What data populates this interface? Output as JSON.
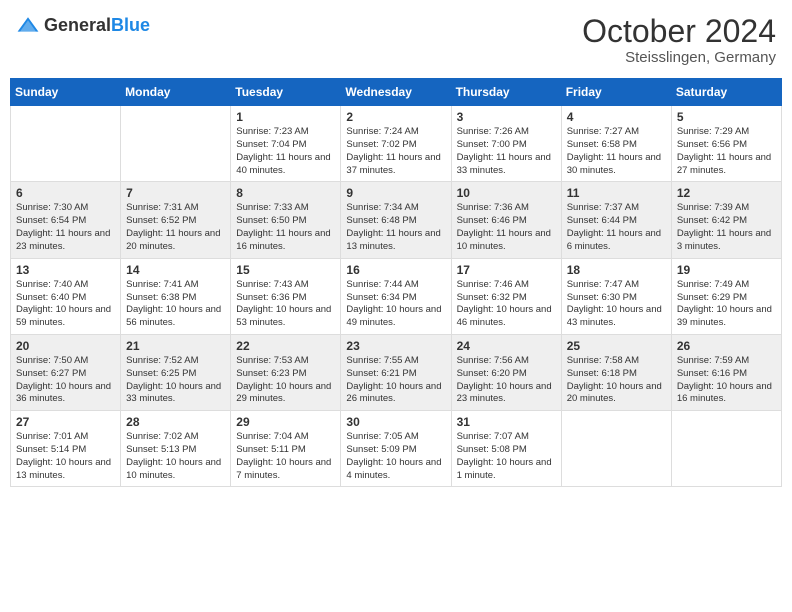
{
  "header": {
    "logo_general": "General",
    "logo_blue": "Blue",
    "month_year": "October 2024",
    "location": "Steisslingen, Germany"
  },
  "days_of_week": [
    "Sunday",
    "Monday",
    "Tuesday",
    "Wednesday",
    "Thursday",
    "Friday",
    "Saturday"
  ],
  "weeks": [
    [
      {
        "day": "",
        "info": ""
      },
      {
        "day": "",
        "info": ""
      },
      {
        "day": "1",
        "info": "Sunrise: 7:23 AM\nSunset: 7:04 PM\nDaylight: 11 hours and 40 minutes."
      },
      {
        "day": "2",
        "info": "Sunrise: 7:24 AM\nSunset: 7:02 PM\nDaylight: 11 hours and 37 minutes."
      },
      {
        "day": "3",
        "info": "Sunrise: 7:26 AM\nSunset: 7:00 PM\nDaylight: 11 hours and 33 minutes."
      },
      {
        "day": "4",
        "info": "Sunrise: 7:27 AM\nSunset: 6:58 PM\nDaylight: 11 hours and 30 minutes."
      },
      {
        "day": "5",
        "info": "Sunrise: 7:29 AM\nSunset: 6:56 PM\nDaylight: 11 hours and 27 minutes."
      }
    ],
    [
      {
        "day": "6",
        "info": "Sunrise: 7:30 AM\nSunset: 6:54 PM\nDaylight: 11 hours and 23 minutes."
      },
      {
        "day": "7",
        "info": "Sunrise: 7:31 AM\nSunset: 6:52 PM\nDaylight: 11 hours and 20 minutes."
      },
      {
        "day": "8",
        "info": "Sunrise: 7:33 AM\nSunset: 6:50 PM\nDaylight: 11 hours and 16 minutes."
      },
      {
        "day": "9",
        "info": "Sunrise: 7:34 AM\nSunset: 6:48 PM\nDaylight: 11 hours and 13 minutes."
      },
      {
        "day": "10",
        "info": "Sunrise: 7:36 AM\nSunset: 6:46 PM\nDaylight: 11 hours and 10 minutes."
      },
      {
        "day": "11",
        "info": "Sunrise: 7:37 AM\nSunset: 6:44 PM\nDaylight: 11 hours and 6 minutes."
      },
      {
        "day": "12",
        "info": "Sunrise: 7:39 AM\nSunset: 6:42 PM\nDaylight: 11 hours and 3 minutes."
      }
    ],
    [
      {
        "day": "13",
        "info": "Sunrise: 7:40 AM\nSunset: 6:40 PM\nDaylight: 10 hours and 59 minutes."
      },
      {
        "day": "14",
        "info": "Sunrise: 7:41 AM\nSunset: 6:38 PM\nDaylight: 10 hours and 56 minutes."
      },
      {
        "day": "15",
        "info": "Sunrise: 7:43 AM\nSunset: 6:36 PM\nDaylight: 10 hours and 53 minutes."
      },
      {
        "day": "16",
        "info": "Sunrise: 7:44 AM\nSunset: 6:34 PM\nDaylight: 10 hours and 49 minutes."
      },
      {
        "day": "17",
        "info": "Sunrise: 7:46 AM\nSunset: 6:32 PM\nDaylight: 10 hours and 46 minutes."
      },
      {
        "day": "18",
        "info": "Sunrise: 7:47 AM\nSunset: 6:30 PM\nDaylight: 10 hours and 43 minutes."
      },
      {
        "day": "19",
        "info": "Sunrise: 7:49 AM\nSunset: 6:29 PM\nDaylight: 10 hours and 39 minutes."
      }
    ],
    [
      {
        "day": "20",
        "info": "Sunrise: 7:50 AM\nSunset: 6:27 PM\nDaylight: 10 hours and 36 minutes."
      },
      {
        "day": "21",
        "info": "Sunrise: 7:52 AM\nSunset: 6:25 PM\nDaylight: 10 hours and 33 minutes."
      },
      {
        "day": "22",
        "info": "Sunrise: 7:53 AM\nSunset: 6:23 PM\nDaylight: 10 hours and 29 minutes."
      },
      {
        "day": "23",
        "info": "Sunrise: 7:55 AM\nSunset: 6:21 PM\nDaylight: 10 hours and 26 minutes."
      },
      {
        "day": "24",
        "info": "Sunrise: 7:56 AM\nSunset: 6:20 PM\nDaylight: 10 hours and 23 minutes."
      },
      {
        "day": "25",
        "info": "Sunrise: 7:58 AM\nSunset: 6:18 PM\nDaylight: 10 hours and 20 minutes."
      },
      {
        "day": "26",
        "info": "Sunrise: 7:59 AM\nSunset: 6:16 PM\nDaylight: 10 hours and 16 minutes."
      }
    ],
    [
      {
        "day": "27",
        "info": "Sunrise: 7:01 AM\nSunset: 5:14 PM\nDaylight: 10 hours and 13 minutes."
      },
      {
        "day": "28",
        "info": "Sunrise: 7:02 AM\nSunset: 5:13 PM\nDaylight: 10 hours and 10 minutes."
      },
      {
        "day": "29",
        "info": "Sunrise: 7:04 AM\nSunset: 5:11 PM\nDaylight: 10 hours and 7 minutes."
      },
      {
        "day": "30",
        "info": "Sunrise: 7:05 AM\nSunset: 5:09 PM\nDaylight: 10 hours and 4 minutes."
      },
      {
        "day": "31",
        "info": "Sunrise: 7:07 AM\nSunset: 5:08 PM\nDaylight: 10 hours and 1 minute."
      },
      {
        "day": "",
        "info": ""
      },
      {
        "day": "",
        "info": ""
      }
    ]
  ]
}
